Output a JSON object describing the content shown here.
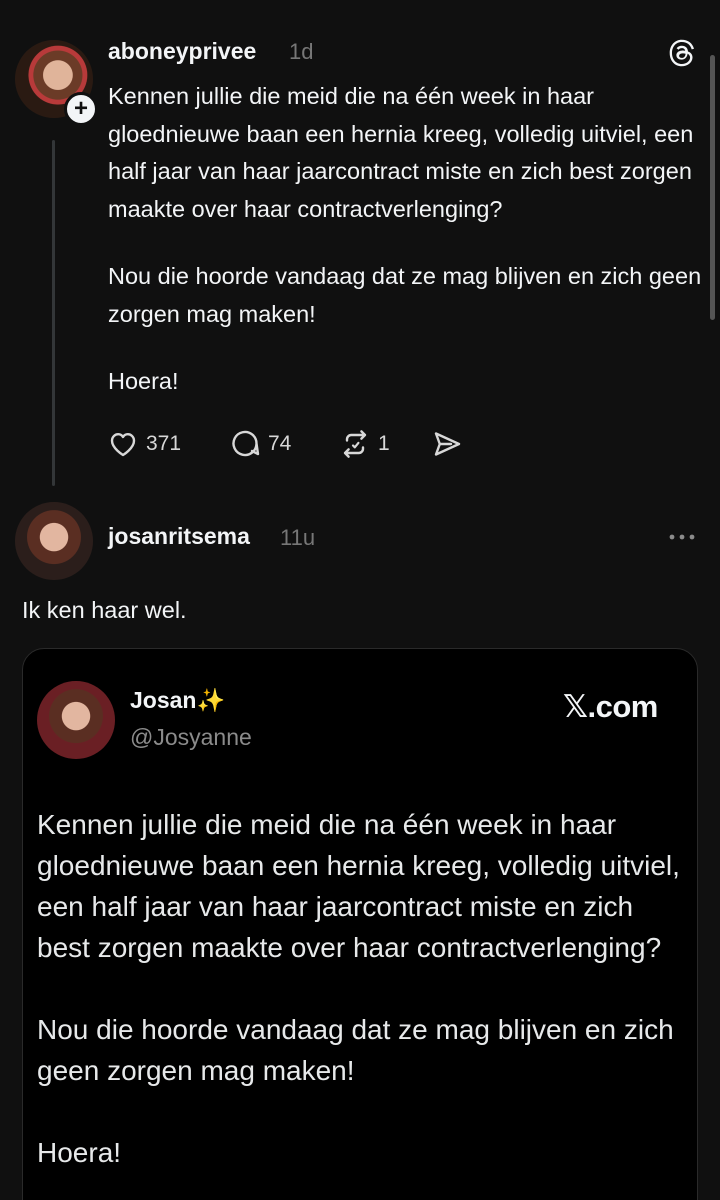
{
  "post": {
    "username": "aboneyprivee",
    "timestamp": "1d",
    "follow_symbol": "+",
    "paragraphs": [
      "Kennen jullie die meid die na één week in haar gloednieuwe baan een hernia kreeg, volledig uitviel, een half jaar van haar jaarcontract miste en zich best zorgen maakte over haar contractverlenging?",
      "Nou die hoorde vandaag dat ze mag blijven en zich geen zorgen mag maken!",
      "Hoera!"
    ],
    "likes": "371",
    "replies": "74",
    "reposts": "1",
    "icons": [
      "threads-logo-icon",
      "heart-icon",
      "comment-icon",
      "repost-icon",
      "share-icon"
    ]
  },
  "reply": {
    "username": "josanritsema",
    "timestamp": "11u",
    "text": "Ik ken haar wel.",
    "icons": [
      "more-options-icon"
    ]
  },
  "embed": {
    "display_name": "Josan",
    "sparkle": "✨",
    "handle": "@Josyanne",
    "source": "𝕏.com",
    "paragraphs": [
      "Kennen jullie die meid die na één week in haar gloednieuwe baan een hernia kreeg, volledig uitviel, een half jaar van haar jaarcontract miste en zich best zorgen maakte over haar contractverlenging?",
      "Nou die hoorde vandaag dat ze mag blijven en zich geen zorgen mag maken!",
      "Hoera!"
    ]
  },
  "colors": {
    "background": "#101010",
    "embed_background": "#000000",
    "text": "#f3f5f7",
    "muted": "#777777",
    "sparkle": "#f6c341"
  }
}
